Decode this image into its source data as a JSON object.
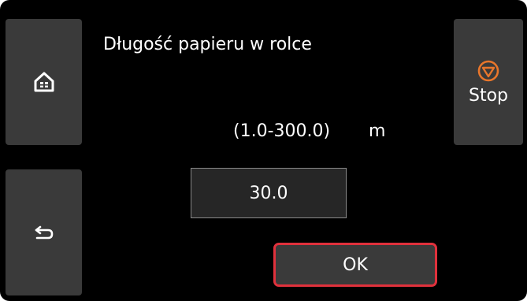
{
  "screen": {
    "title": "Długość papieru w rolce",
    "range": "(1.0-300.0)",
    "unit": "m",
    "value": "30.0"
  },
  "buttons": {
    "ok_label": "OK",
    "stop_label": "Stop",
    "home_icon": "home-icon",
    "back_icon": "back-arrow-icon",
    "stop_icon": "stop-icon"
  },
  "colors": {
    "background": "#000000",
    "button": "#3a3a3a",
    "focus_border": "#e0313c",
    "stop_accent": "#e8762b"
  }
}
